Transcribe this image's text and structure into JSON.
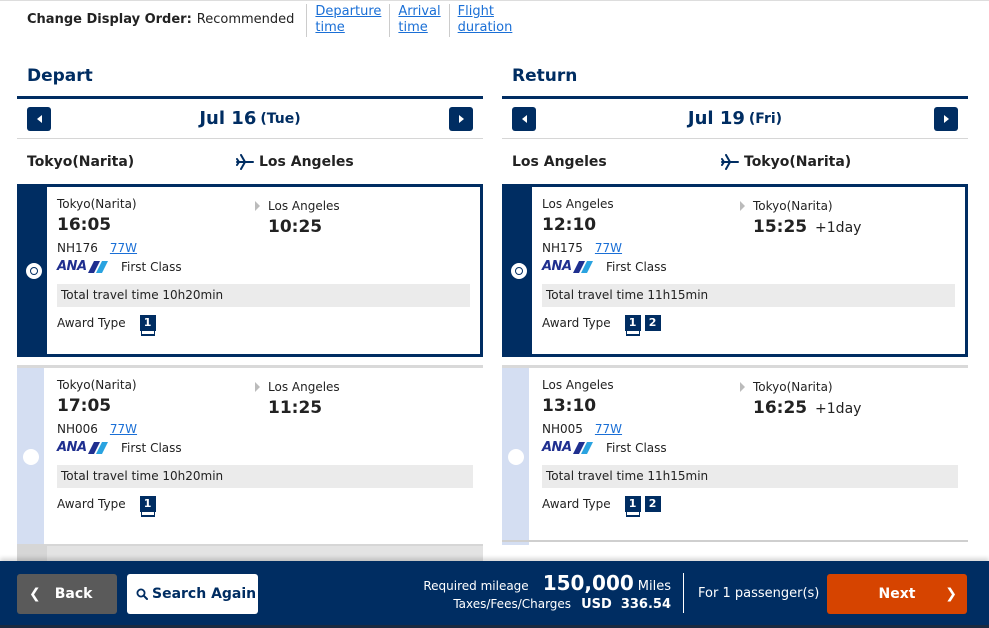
{
  "sort": {
    "label": "Change Display Order:",
    "current": "Recommended",
    "options": [
      {
        "line1": "Departure",
        "line2": "time"
      },
      {
        "line1": "Arrival",
        "line2": "time"
      },
      {
        "line1": "Flight",
        "line2": "duration"
      }
    ]
  },
  "depart": {
    "title": "Depart",
    "date": "Jul 16",
    "day": "(Tue)",
    "from": "Tokyo(Narita)",
    "to": "Los Angeles",
    "flights": [
      {
        "from": "Tokyo(Narita)",
        "dep": "16:05",
        "to": "Los Angeles",
        "arr": "10:25",
        "plus": "",
        "flight": "NH176",
        "aircraft": "77W",
        "airline": "ANA",
        "cabin": "First Class",
        "total": "Total travel time 10h20min",
        "award_label": "Award Type",
        "awards": [
          "1"
        ],
        "selected": true
      },
      {
        "from": "Tokyo(Narita)",
        "dep": "17:05",
        "to": "Los Angeles",
        "arr": "11:25",
        "plus": "",
        "flight": "NH006",
        "aircraft": "77W",
        "airline": "ANA",
        "cabin": "First Class",
        "total": "Total travel time 10h20min",
        "award_label": "Award Type",
        "awards": [
          "1"
        ],
        "selected": false
      }
    ]
  },
  "return": {
    "title": "Return",
    "date": "Jul 19",
    "day": "(Fri)",
    "from": "Los Angeles",
    "to": "Tokyo(Narita)",
    "flights": [
      {
        "from": "Los Angeles",
        "dep": "12:10",
        "to": "Tokyo(Narita)",
        "arr": "15:25",
        "plus": "+1day",
        "flight": "NH175",
        "aircraft": "77W",
        "airline": "ANA",
        "cabin": "First Class",
        "total": "Total travel time 11h15min",
        "award_label": "Award Type",
        "awards": [
          "1",
          "2"
        ],
        "selected": true
      },
      {
        "from": "Los Angeles",
        "dep": "13:10",
        "to": "Tokyo(Narita)",
        "arr": "16:25",
        "plus": "+1day",
        "flight": "NH005",
        "aircraft": "77W",
        "airline": "ANA",
        "cabin": "First Class",
        "total": "Total travel time 11h15min",
        "award_label": "Award Type",
        "awards": [
          "1",
          "2"
        ],
        "selected": false
      }
    ]
  },
  "footer": {
    "back_label": "Back",
    "search_label": "Search Again",
    "mileage_label": "Required mileage",
    "mileage_value": "150,000",
    "mileage_unit": "Miles",
    "tax_label": "Taxes/Fees/Charges",
    "tax_value": "USD  336.54",
    "passengers": "For 1 passenger(s)",
    "next_label": "Next"
  },
  "colors": {
    "brand_navy": "#002d62",
    "next_orange": "#d64400",
    "link_blue": "#1a6fd6",
    "rail_light": "#d4def2"
  }
}
